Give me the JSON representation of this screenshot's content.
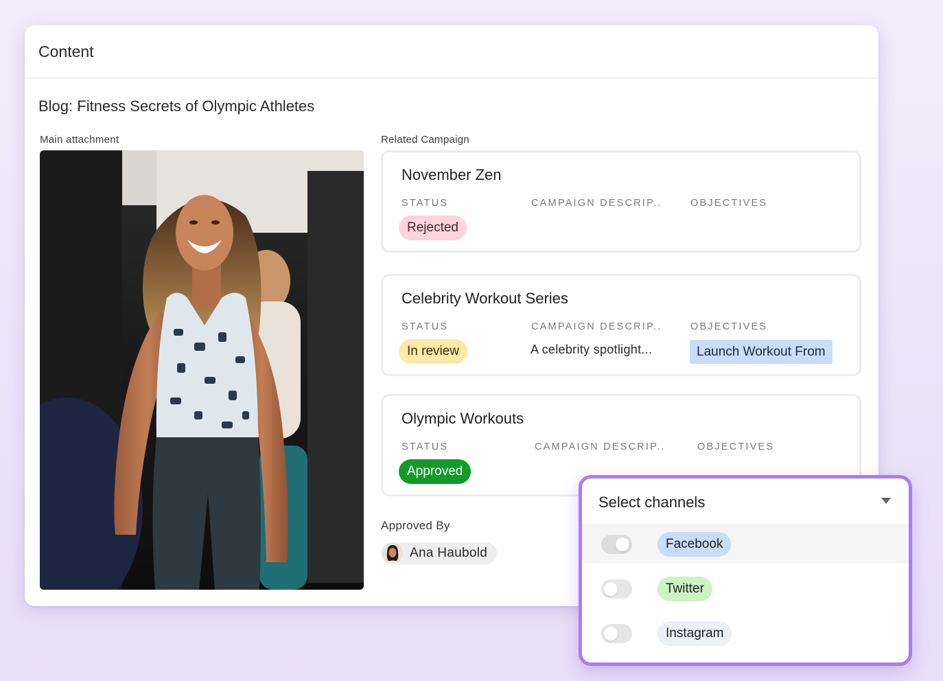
{
  "panel": {
    "title": "Content"
  },
  "record": {
    "title": "Blog: Fitness Secrets of Olympic Athletes"
  },
  "labels": {
    "main_attachment": "Main attachment",
    "related_campaign": "Related Campaign",
    "approved_by": "Approved By"
  },
  "columns": {
    "status": "STATUS",
    "description": "CAMPAIGN DESCRIP..",
    "objectives": "OBJECTIVES"
  },
  "campaigns": [
    {
      "name": "November Zen",
      "status": "Rejected",
      "description": "",
      "objective": ""
    },
    {
      "name": "Celebrity Workout Series",
      "status": "In review",
      "description": "A celebrity spotlight...",
      "objective": "Launch Workout From"
    },
    {
      "name": "Olympic Workouts",
      "status": "Approved",
      "description": "",
      "objective": ""
    }
  ],
  "approver": {
    "name": "Ana Haubold"
  },
  "channels": {
    "title": "Select channels",
    "options": [
      {
        "label": "Facebook",
        "color": "#c9dcfa"
      },
      {
        "label": "Twitter",
        "color": "#cdf2c3"
      },
      {
        "label": "Instagram",
        "color": "#edf0f5"
      }
    ]
  },
  "colors": {
    "accent_border": "#a97ef0",
    "status_rejected": "#fcd3de",
    "status_review": "#fde9a8",
    "status_approved": "#139a2a"
  }
}
